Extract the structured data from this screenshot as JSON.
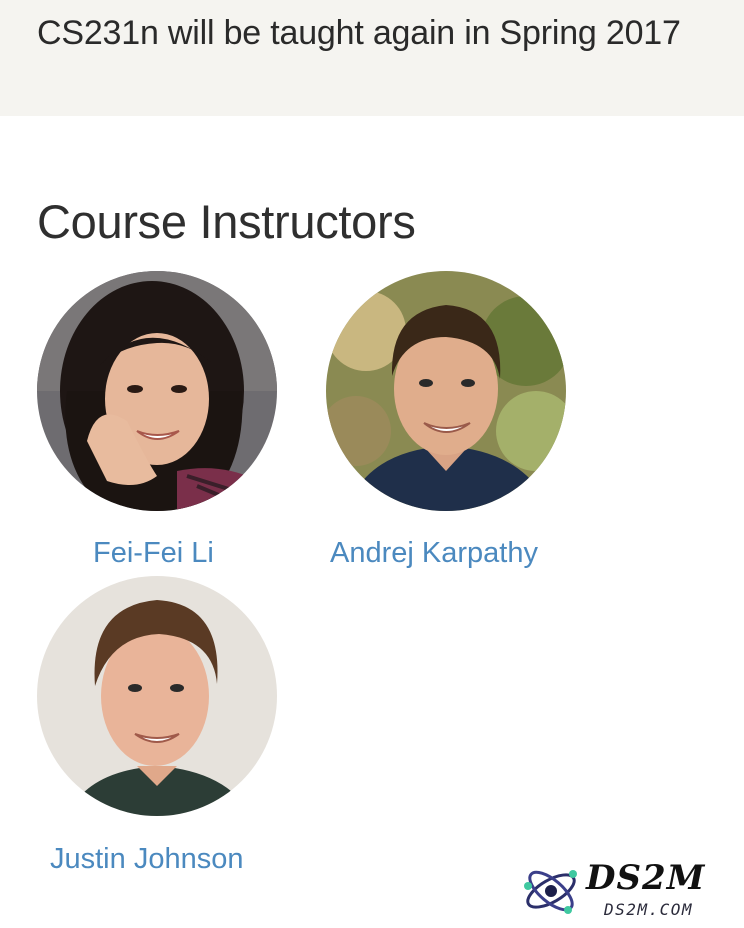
{
  "banner": {
    "text": "CS231n will be taught again in Spring 2017"
  },
  "section": {
    "title": "Course Instructors"
  },
  "instructors": [
    {
      "name": "Fei-Fei Li"
    },
    {
      "name": "Andrej Karpathy"
    },
    {
      "name": "Justin Johnson"
    }
  ],
  "watermark": {
    "title": "DS2M",
    "subtitle": "DS2M.COM"
  },
  "colors": {
    "banner_bg": "#f5f4f0",
    "link": "#4b89bf",
    "heading": "#2f2f2f"
  }
}
